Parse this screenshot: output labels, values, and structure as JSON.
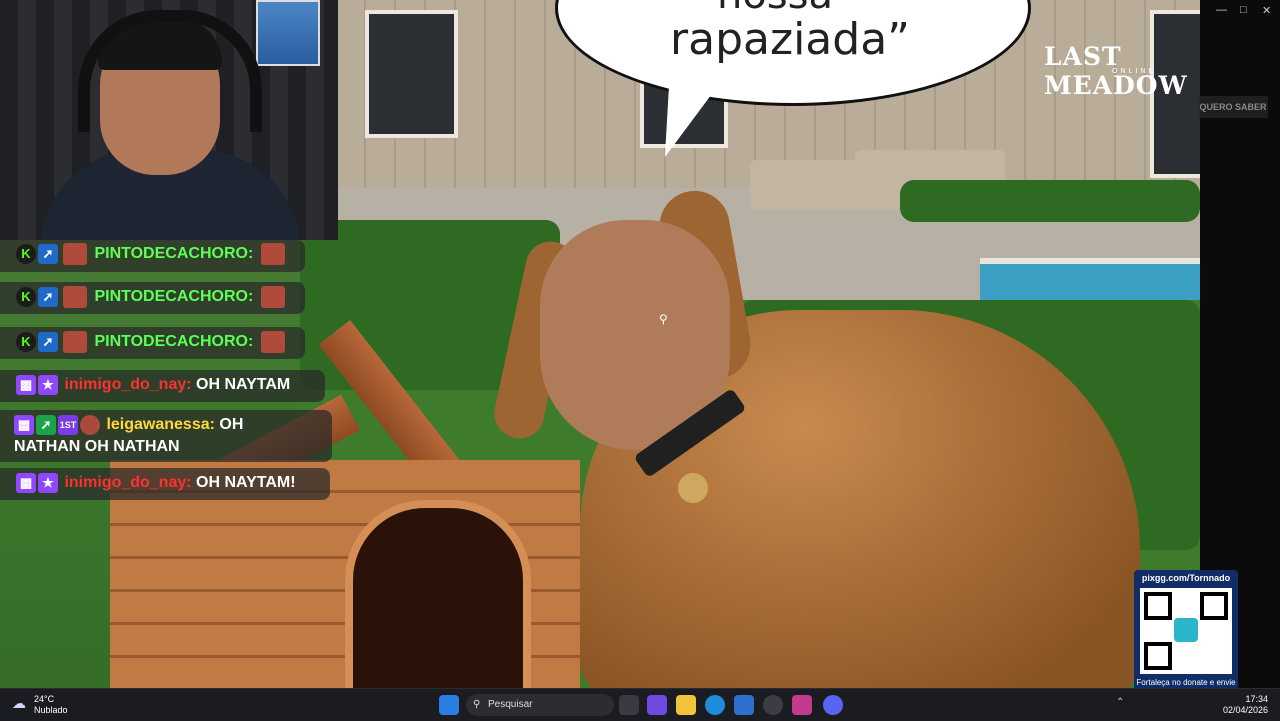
{
  "video": {
    "speech_bubble_top": "nossa",
    "speech_bubble": "rapaziada”",
    "brand": "LAST MEADOW",
    "brand_sub": "ONLINE",
    "ghost_button": "QUERO SABER",
    "close_symbol": "✕"
  },
  "window_controls": {
    "minimize": "—",
    "maximize": "□",
    "close": "✕"
  },
  "chat": {
    "messages": [
      {
        "user": "PINTODECACHORO:",
        "text": ""
      },
      {
        "user": "PINTODECACHORO:",
        "text": ""
      },
      {
        "user": "PINTODECACHORO:",
        "text": ""
      },
      {
        "user": "inimigo_do_nay:",
        "text": "OH NAYTAM"
      },
      {
        "user": "leigawanessa:",
        "text": "OH",
        "text2": "NATHAN OH NATHAN"
      },
      {
        "user": "inimigo_do_nay:",
        "text": "OH NAYTAM!"
      }
    ],
    "first_badge": "1ST"
  },
  "qr": {
    "url": "pixgg.com/Tornnado",
    "note": "Fortaleça no donate e envie sua mensagem!"
  },
  "taskbar": {
    "temp": "24°C",
    "condition": "Nublado",
    "search_placeholder": "Pesquisar",
    "time": "17:34",
    "date": "02/04/2026"
  },
  "colors": {
    "kick": "#53fc18",
    "twitch": "#9146ff",
    "qr_bg": "#112d68"
  }
}
